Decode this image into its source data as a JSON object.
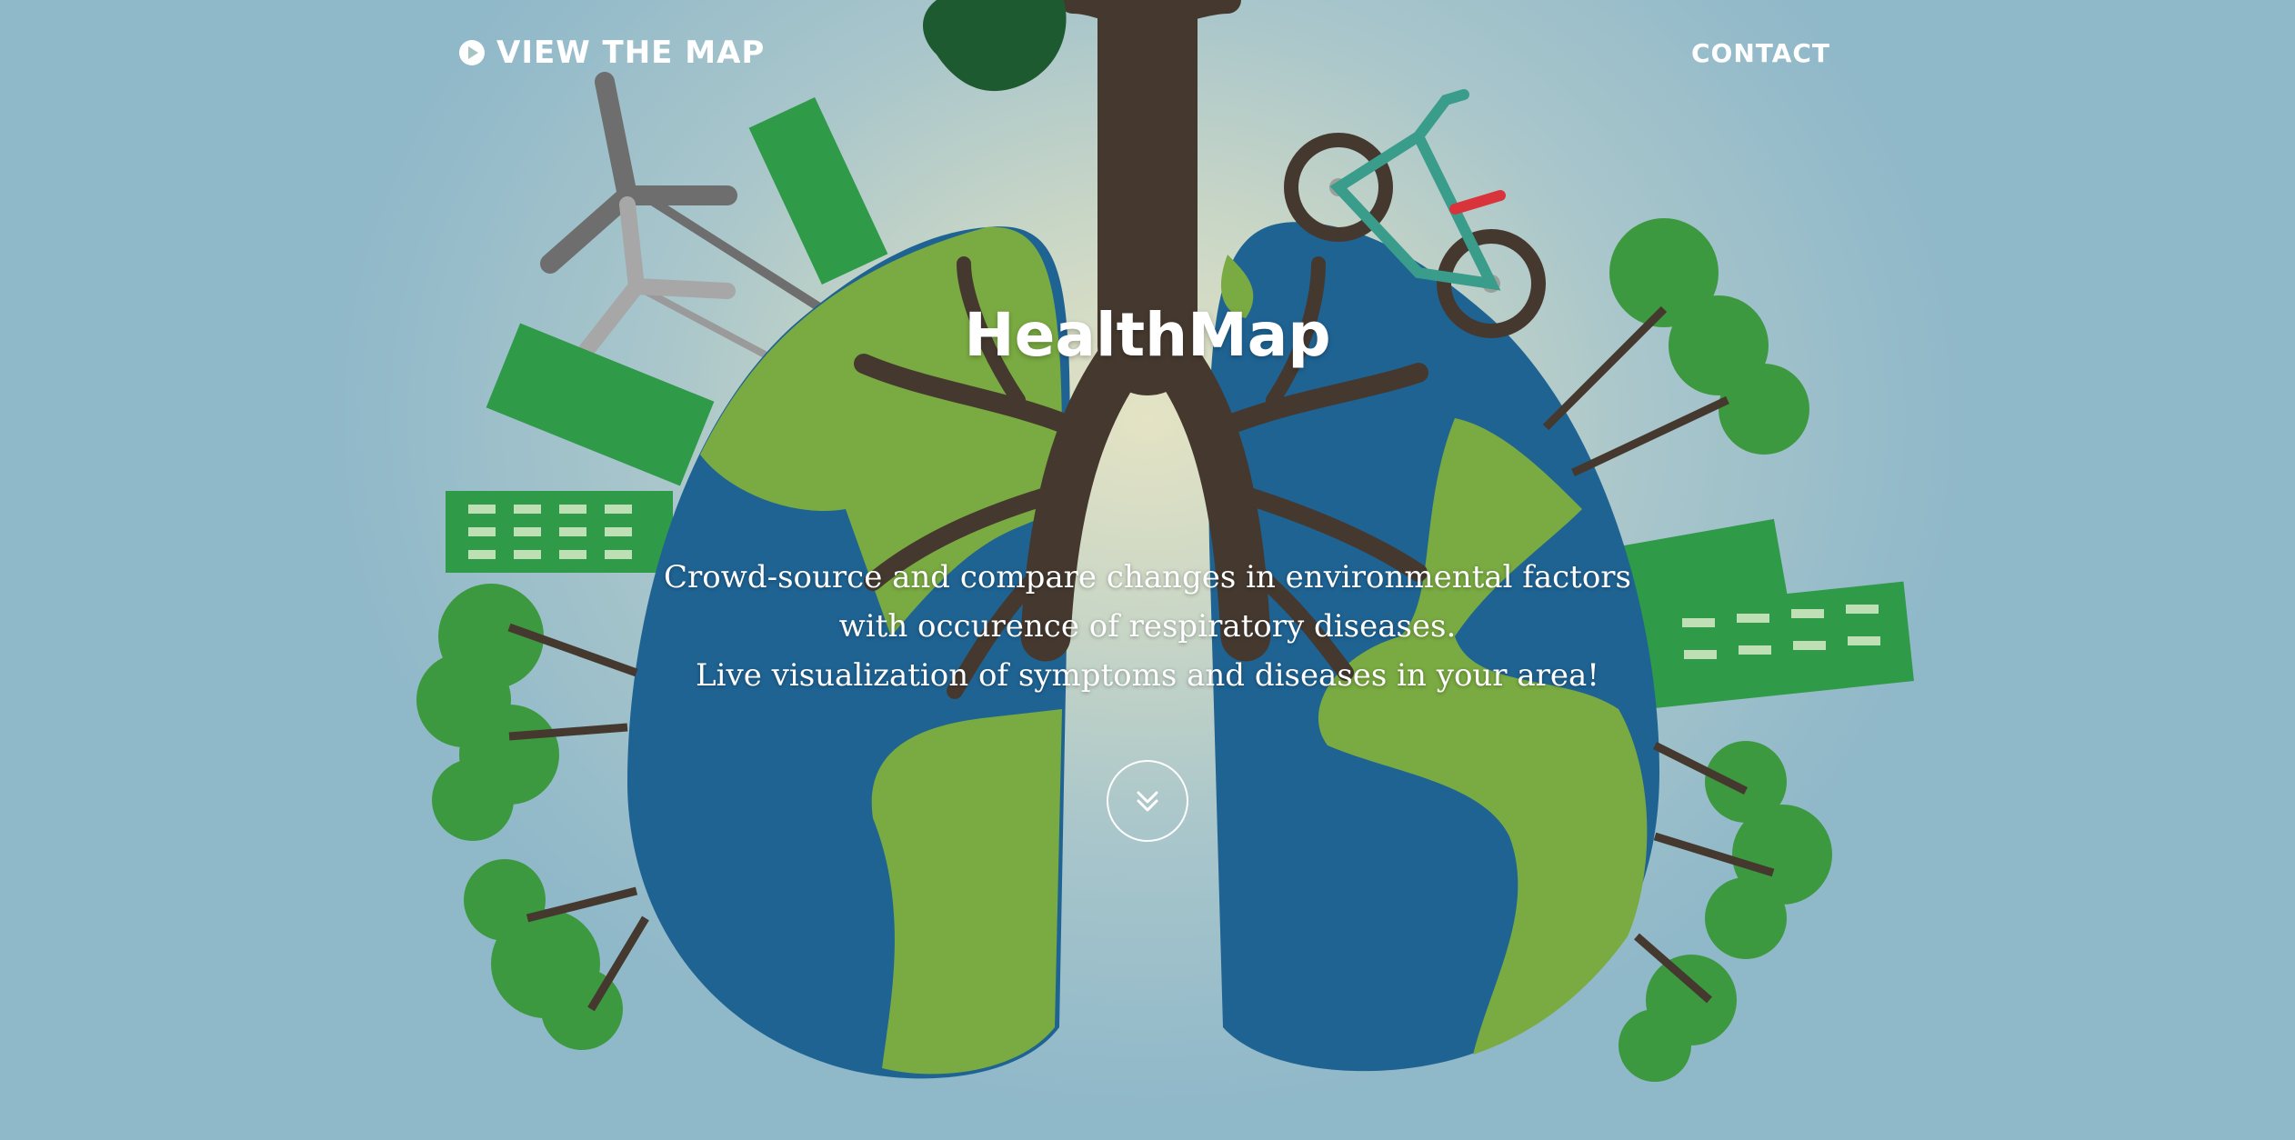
{
  "nav": {
    "view_map_label": "VIEW THE MAP",
    "contact_label": "CONTACT"
  },
  "hero": {
    "title": "HealthMap",
    "tagline_lines": [
      "Crowd-source and compare changes in environmental factors",
      "with occurence of respiratory diseases.",
      "Live visualization of symptoms and diseases in your area!"
    ]
  },
  "icons": {
    "view_map": "play-circle-icon",
    "scroll": "double-chevron-down-icon"
  },
  "colors": {
    "ocean": "#1f6393",
    "land": "#7aaa42",
    "tree": "#3d9940",
    "building": "#2f9a48",
    "trunk": "#45392f",
    "text": "#ffffff"
  }
}
